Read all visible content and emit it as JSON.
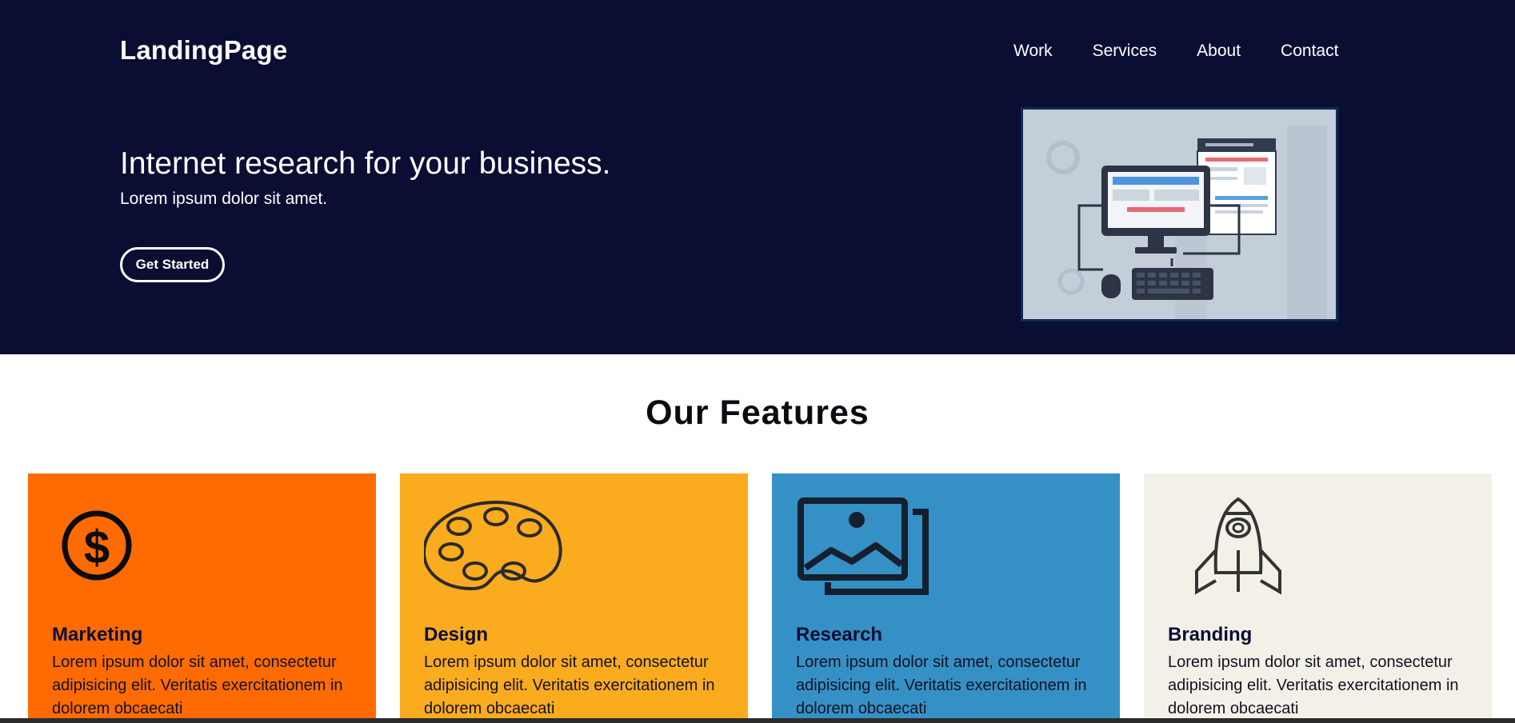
{
  "brand": "LandingPage",
  "nav": {
    "items": [
      "Work",
      "Services",
      "About",
      "Contact"
    ]
  },
  "hero": {
    "headline": "Internet research for your business.",
    "subline": "Lorem ipsum dolor sit amet.",
    "cta_label": "Get Started",
    "illustration_icon": "computer-dashboard-illustration"
  },
  "features": {
    "title": "Our Features",
    "cards": [
      {
        "title": "Marketing",
        "text": "Lorem ipsum dolor sit amet, consectetur adipisicing elit. Veritatis exercitationem in dolorem obcaecati",
        "icon": "dollar-icon",
        "color": "#ff6b00"
      },
      {
        "title": "Design",
        "text": "Lorem ipsum dolor sit amet, consectetur adipisicing elit. Veritatis exercitationem in dolorem obcaecati",
        "icon": "palette-icon",
        "color": "#fbab1e"
      },
      {
        "title": "Research",
        "text": "Lorem ipsum dolor sit amet, consectetur adipisicing elit. Veritatis exercitationem in dolorem obcaecati",
        "icon": "image-gallery-icon",
        "color": "#3590c5"
      },
      {
        "title": "Branding",
        "text": "Lorem ipsum dolor sit amet, consectetur adipisicing elit. Veritatis exercitationem in dolorem obcaecati",
        "icon": "rocket-icon",
        "color": "#f3f1e7"
      }
    ]
  },
  "colors": {
    "hero_bg": "#0b0e33",
    "page_bg": "#ffffff"
  }
}
